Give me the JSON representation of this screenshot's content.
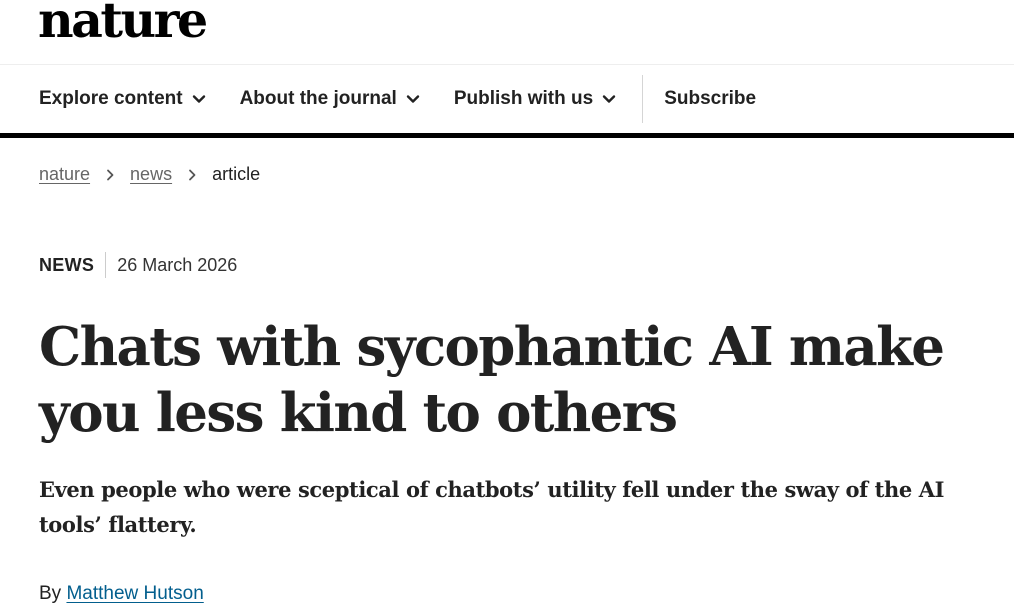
{
  "header": {
    "logo_text": "nature"
  },
  "nav": {
    "items": [
      {
        "label": "Explore content",
        "icon": "chevron-down-icon"
      },
      {
        "label": "About the journal",
        "icon": "chevron-down-icon"
      },
      {
        "label": "Publish with us",
        "icon": "chevron-down-icon"
      }
    ],
    "subscribe_label": "Subscribe"
  },
  "breadcrumb": {
    "items": [
      "nature",
      "news"
    ],
    "current": "article",
    "separator_icon": "chevron-right-icon"
  },
  "article": {
    "type": "NEWS",
    "date": "26 March 2026",
    "title": "Chats with sycophantic AI make you less kind to others",
    "standfirst": "Even people who were sceptical of chatbots’ utility fell under the sway of the AI tools’ flattery.",
    "byline_prefix": "By",
    "author": "Matthew Hutson"
  },
  "colors": {
    "text": "#222222",
    "link_author": "#025e8d",
    "breadcrumb_link": "#666666",
    "nav_border": "#000000"
  }
}
